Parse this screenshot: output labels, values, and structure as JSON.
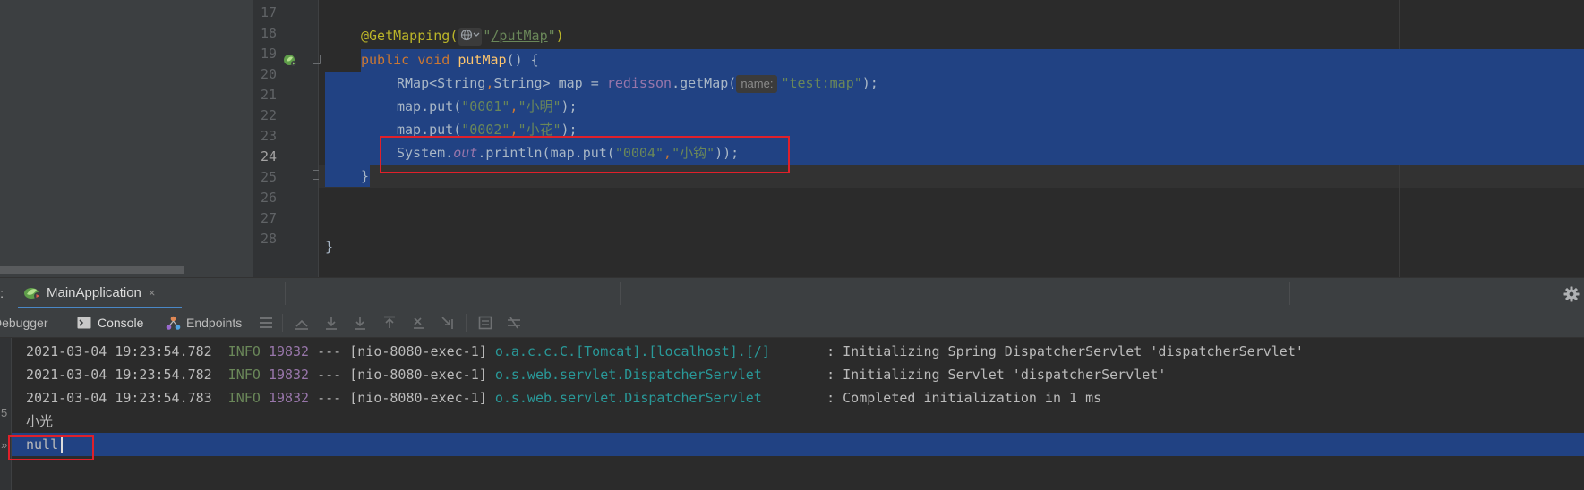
{
  "editor": {
    "line_numbers": [
      "17",
      "18",
      "19",
      "20",
      "21",
      "22",
      "23",
      "24",
      "25",
      "26",
      "27",
      "28"
    ],
    "annotation": "@GetMapping(",
    "mapping_path": "/putMap",
    "access_modifier": "public",
    "return_type": "void",
    "method_name": "putMap",
    "method_params": "() {",
    "line20_type": "RMap<String",
    "line20_comma": ",",
    "line20_rest": "String> map = ",
    "line20_field": "redisson",
    "line20_call": ".getMap(",
    "param_hint": "name:",
    "line20_arg": "\"test:map\"",
    "line20_end": ");",
    "put1_prefix": "map.put(",
    "put1_key": "\"0001\"",
    "put1_value": "\"小明\"",
    "put2_key": "\"0002\"",
    "put2_value": "\"小花\"",
    "put_suffix": ");",
    "println_prefix": "System.",
    "println_out": "out",
    "println_mid": ".println(map.put(",
    "println_key": "\"0004\"",
    "println_value": "\"小钩\"",
    "println_end": "));",
    "method_close": "}",
    "class_close": "}"
  },
  "run_window": {
    "header_left_char": ":",
    "tab_label": "MainApplication",
    "tab_close": "×",
    "tabs": {
      "debugger": "Debugger",
      "console": "Console",
      "endpoints": "Endpoints"
    }
  },
  "console": {
    "gutter_glyph_1": "5",
    "gutter_glyph_2": "»",
    "logs": [
      {
        "timestamp": "2021-03-04 19:23:54.782",
        "level": "INFO",
        "pid": "19832",
        "sep": "---",
        "thread": "[nio-8080-exec-1]",
        "logger": "o.a.c.c.C.[Tomcat].[localhost].[/]",
        "message": ": Initializing Spring DispatcherServlet 'dispatcherServlet'"
      },
      {
        "timestamp": "2021-03-04 19:23:54.782",
        "level": "INFO",
        "pid": "19832",
        "sep": "---",
        "thread": "[nio-8080-exec-1]",
        "logger": "o.s.web.servlet.DispatcherServlet",
        "message": ": Initializing Servlet 'dispatcherServlet'"
      },
      {
        "timestamp": "2021-03-04 19:23:54.783",
        "level": "INFO",
        "pid": "19832",
        "sep": "---",
        "thread": "[nio-8080-exec-1]",
        "logger": "o.s.web.servlet.DispatcherServlet",
        "message": ": Completed initialization in 1 ms"
      }
    ],
    "output_1": "小光",
    "output_2": "null"
  },
  "colors": {
    "selection": "#214283",
    "highlight_box": "#e0202a",
    "keyword": "#cc7832",
    "string": "#6a8759",
    "annotation": "#bbb529",
    "method": "#ffc66d",
    "field": "#9876aa",
    "logger": "#299999"
  },
  "icons": {
    "run_gutter": "spring-run-icon",
    "globe": "globe-icon",
    "settings": "gear-icon",
    "console": "console-icon",
    "endpoints": "endpoints-icon"
  }
}
